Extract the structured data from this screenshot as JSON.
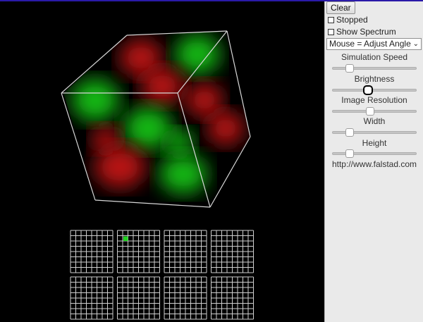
{
  "panel": {
    "clear_label": "Clear",
    "stopped_label": "Stopped",
    "show_spectrum_label": "Show Spectrum",
    "mouse_mode": "Mouse = Adjust Angle",
    "url": "http://www.falstad.com",
    "sliders": [
      {
        "label": "Simulation Speed",
        "value": 0.2
      },
      {
        "label": "Brightness",
        "value": 0.42
      },
      {
        "label": "Image Resolution",
        "value": 0.45
      },
      {
        "label": "Width",
        "value": 0.2
      },
      {
        "label": "Height",
        "value": 0.2
      }
    ]
  },
  "grid": {
    "rows": 2,
    "cols": 4,
    "cells_per_side": 8,
    "selected_mode": {
      "row": 0,
      "col": 1,
      "cell_x": 1,
      "cell_y": 1
    },
    "line_color": "#cfcfcf",
    "selected_color": "#1ed21e"
  },
  "view": {
    "cube_edge_color": "#d8d8d8",
    "green_color": "#17c417",
    "red_color": "#c41414"
  }
}
